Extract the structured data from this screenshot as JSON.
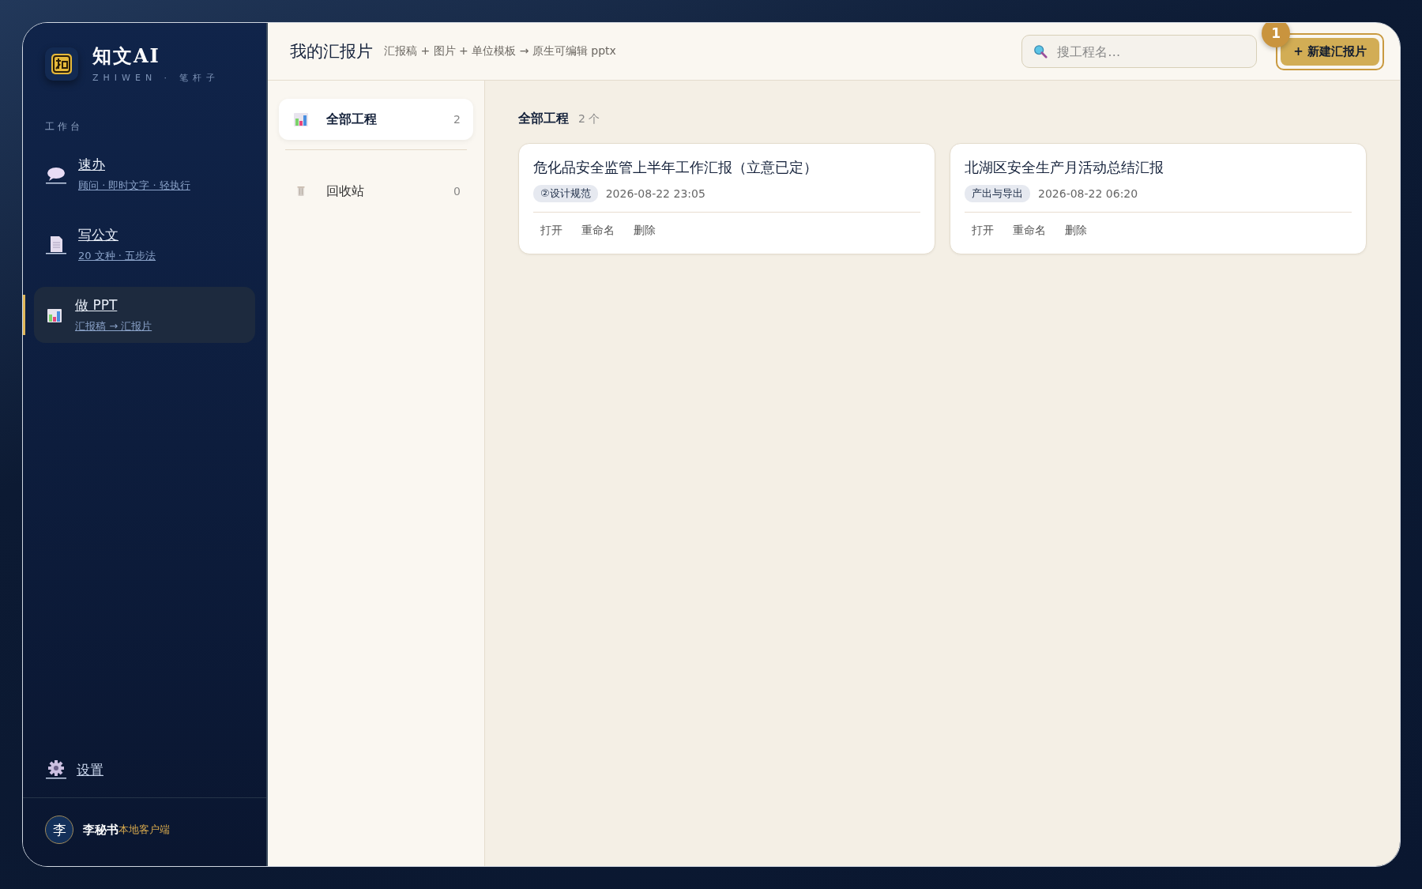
{
  "brand": {
    "name": "知文AI",
    "tagline": "ZHIWEN · 笔杆子"
  },
  "sidebar": {
    "section_label": "工作台",
    "items": [
      {
        "title": "速办",
        "subtitle": "顾问 · 即时文字 · 轻执行",
        "selected": false
      },
      {
        "title": "写公文",
        "subtitle": "20 文种 · 五步法",
        "selected": false
      },
      {
        "title": "做 PPT",
        "subtitle": "汇报稿 → 汇报片",
        "selected": true
      }
    ],
    "settings": "设置",
    "user": {
      "avatar": "李",
      "name": "李秘书",
      "note": "本地客户端"
    }
  },
  "header": {
    "title": "我的汇报片",
    "subtitle": "汇报稿 + 图片 + 单位模板 → 原生可编辑 pptx",
    "search": {
      "placeholder": "搜工程名…"
    },
    "new_button": "+ 新建汇报片",
    "badge": "1"
  },
  "folders": [
    {
      "label": "全部工程",
      "count": "2",
      "selected": true
    },
    {
      "label": "回收站",
      "count": "0",
      "selected": false
    }
  ],
  "content": {
    "title": "全部工程",
    "count": "2 个",
    "projects": [
      {
        "title": "危化品安全监管上半年工作汇报（立意已定）",
        "tag": "②设计规范",
        "time": "2026-08-22 23:05",
        "actions": [
          "打开",
          "重命名",
          "删除"
        ]
      },
      {
        "title": "北湖区安全生产月活动总结汇报",
        "tag": "产出与导出",
        "time": "2026-08-22 06:20",
        "actions": [
          "打开",
          "重命名",
          "删除"
        ]
      }
    ]
  }
}
